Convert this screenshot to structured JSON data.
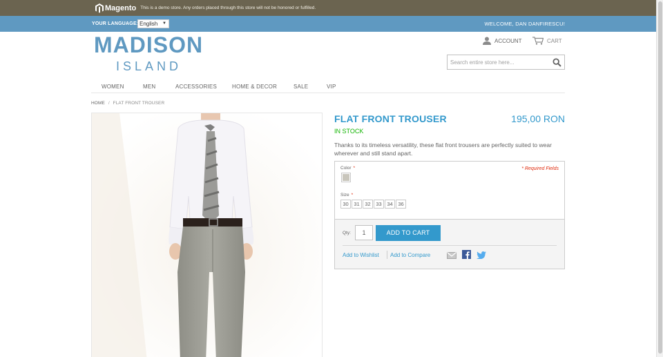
{
  "demo_bar": {
    "brand": "Magento",
    "notice": "This is a demo store. Any orders placed through this store will not be honored or fulfilled."
  },
  "header_bar": {
    "language_label": "YOUR LANGUAGE:",
    "language_value": "English",
    "welcome": "WELCOME, DAN DANFIRESCU!"
  },
  "logo": {
    "main": "MADISON",
    "sub": "ISLAND"
  },
  "account": {
    "account_label": "ACCOUNT",
    "cart_label": "CART"
  },
  "search": {
    "placeholder": "Search entire store here..."
  },
  "nav": {
    "items": [
      {
        "label": "WOMEN"
      },
      {
        "label": "MEN"
      },
      {
        "label": "ACCESSORIES"
      },
      {
        "label": "HOME & DECOR"
      },
      {
        "label": "SALE"
      },
      {
        "label": "VIP"
      }
    ]
  },
  "breadcrumb": {
    "home": "HOME",
    "separator": "/",
    "current": "FLAT FRONT TROUSER"
  },
  "product": {
    "name": "FLAT FRONT TROUSER",
    "price": "195,00 RON",
    "stock": "IN STOCK",
    "description": "Thanks to its timeless versatility, these flat front trousers are perfectly suited to wear wherever and still stand apart.",
    "color_label": "Color",
    "size_label": "Size",
    "required_mark": "*",
    "required_note": "* Required Fields",
    "sizes": [
      "30",
      "31",
      "32",
      "33",
      "34",
      "36"
    ],
    "qty_label": "Qty:",
    "qty_value": "1",
    "add_to_cart": "ADD TO CART",
    "wishlist": "Add to Wishlist",
    "compare": "Add to Compare"
  },
  "colors": {
    "accent": "#3399cc",
    "brand_bar": "#5f99c1",
    "demo_bar": "#6b6450",
    "stock": "#11b400",
    "required": "#df280a"
  },
  "icons": [
    "magento-logo-icon",
    "account-icon",
    "cart-icon",
    "search-icon",
    "email-icon",
    "facebook-icon",
    "twitter-icon"
  ]
}
